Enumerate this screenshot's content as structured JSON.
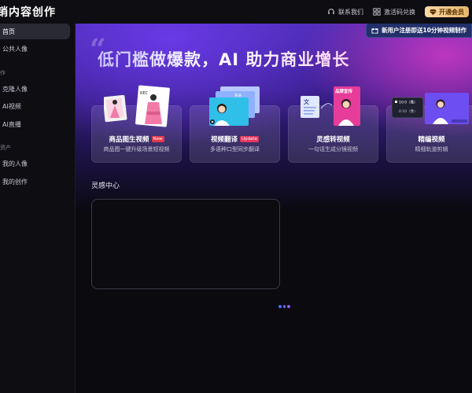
{
  "header": {
    "brand": "销内容创作",
    "contact": "联系我们",
    "redeem": "激活码兑换",
    "vip": "开通会员"
  },
  "sidebar": {
    "items": [
      {
        "label": "首页",
        "active": true
      },
      {
        "label": "公共人像",
        "active": false
      }
    ],
    "section_create": "作",
    "create_items": [
      "克隆人像",
      "AI视频",
      "AI直播"
    ],
    "section_assets": "资产",
    "asset_items": [
      "我的人像",
      "我的创作"
    ]
  },
  "hero": {
    "title": "低门槛做爆款，AI 助力商业增长",
    "promo": "新用户注册即送10分钟视频制作"
  },
  "cards": [
    {
      "title": "商品图生视频",
      "badge": "New",
      "subtitle": "商品图一键升级场景短视频"
    },
    {
      "title": "视频翻译",
      "badge": "Update",
      "subtitle": "多语种口型同步翻译"
    },
    {
      "title": "灵感转视频",
      "badge": "",
      "subtitle": "一句话生成分镜视频"
    },
    {
      "title": "精编视频",
      "badge": "",
      "subtitle": "精细轨道剪辑"
    }
  ],
  "illus_text": {
    "rec": "REC",
    "card2_tag": "英语",
    "doc_glyph": "文",
    "brand_tag": "品牌宣传",
    "track1": "10:0（像）",
    "track2": "0:10（像）"
  },
  "inspiration": {
    "title": "灵感中心"
  },
  "colors": {
    "accent_purple": "#5a36d6",
    "accent_pink": "#e63cc8",
    "vip_gold": "#e8b86c",
    "badge_red": "#e23b4d",
    "loader_blue": "#4c6fff",
    "loader_violet": "#8b5cf6"
  }
}
